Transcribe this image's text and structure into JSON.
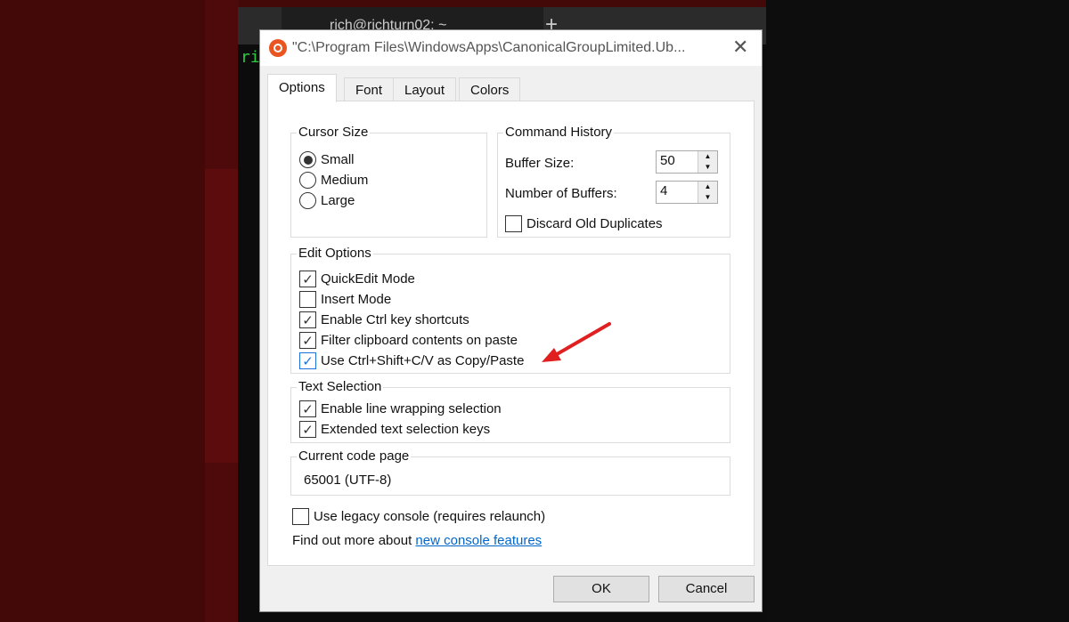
{
  "terminal": {
    "tab_title": "rich@richturn02: ~",
    "prompt_text": "ri",
    "new_tab": "+",
    "close_tab": "✕"
  },
  "dialog": {
    "title": "\"C:\\Program Files\\WindowsApps\\CanonicalGroupLimited.Ub...",
    "close": "✕",
    "tabs": [
      {
        "label": "Options",
        "active": true
      },
      {
        "label": "Font"
      },
      {
        "label": "Layout"
      },
      {
        "label": "Colors"
      }
    ],
    "cursor_size": {
      "label": "Cursor Size",
      "options": [
        {
          "label": "Small",
          "selected": true
        },
        {
          "label": "Medium"
        },
        {
          "label": "Large"
        }
      ]
    },
    "command_history": {
      "label": "Command History",
      "buffer_size_label": "Buffer Size:",
      "buffer_size": "50",
      "num_buffers_label": "Number of Buffers:",
      "num_buffers": "4",
      "discard_label": "Discard Old Duplicates",
      "discard_checked": false
    },
    "edit_options": {
      "label": "Edit Options",
      "items": [
        {
          "label": "QuickEdit Mode",
          "checked": true
        },
        {
          "label": "Insert Mode",
          "checked": false
        },
        {
          "label": "Enable Ctrl key shortcuts",
          "checked": true
        },
        {
          "label": "Filter clipboard contents on paste",
          "checked": true
        },
        {
          "label": "Use Ctrl+Shift+C/V as Copy/Paste",
          "checked": true
        }
      ]
    },
    "text_selection": {
      "label": "Text Selection",
      "items": [
        {
          "label": "Enable line wrapping selection",
          "checked": true
        },
        {
          "label": "Extended text selection keys",
          "checked": true
        }
      ]
    },
    "code_page": {
      "label": "Current code page",
      "value": "65001 (UTF-8)"
    },
    "legacy": {
      "label": "Use legacy console (requires relaunch)",
      "checked": false
    },
    "find_more": {
      "text": "Find out more about ",
      "link": "new console features"
    },
    "ok": "OK",
    "cancel": "Cancel",
    "check_glyph": "✓",
    "annotation_color": "#e02020"
  }
}
